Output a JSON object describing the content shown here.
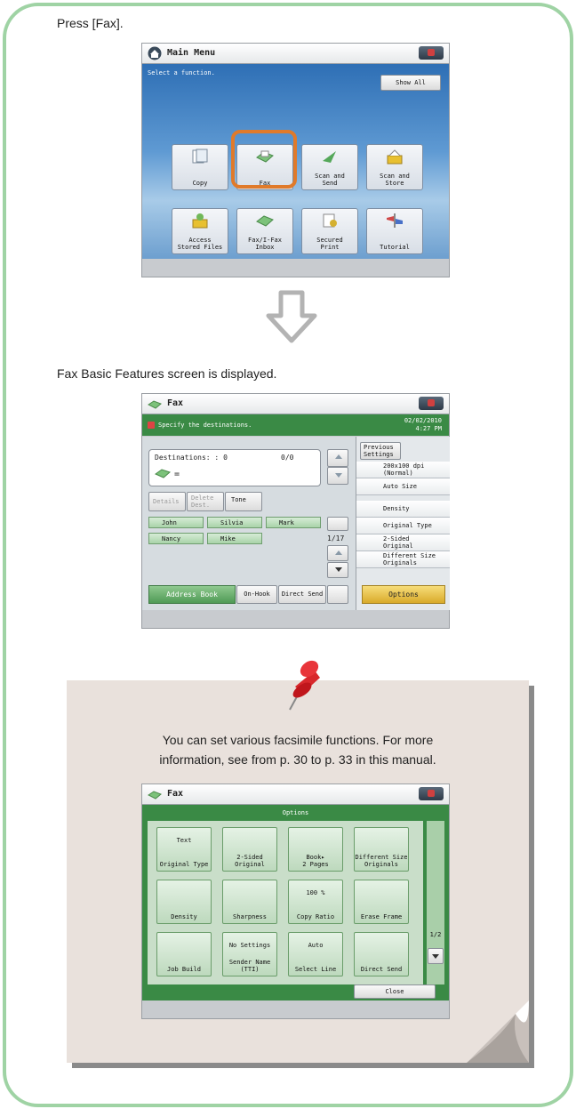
{
  "step1": {
    "text": "Press [Fax]."
  },
  "main_menu": {
    "title": "Main Menu",
    "instruction": "Select a function.",
    "show_all": "Show All",
    "tiles": [
      {
        "label": "Copy"
      },
      {
        "label": "Fax"
      },
      {
        "label": "Scan and\nSend"
      },
      {
        "label": "Scan and\nStore"
      },
      {
        "label": "Access\nStored Files"
      },
      {
        "label": "Fax/I-Fax\nInbox"
      },
      {
        "label": "Secured\nPrint"
      },
      {
        "label": "Tutorial"
      }
    ],
    "highlight_color": "#e07a2a"
  },
  "step2": {
    "text": "Fax Basic Features screen is displayed."
  },
  "fax_screen": {
    "title": "Fax",
    "status_msg": "Specify the destinations.",
    "date": "02/02/2010",
    "time": "4:27 PM",
    "destinations_label": "Destinations: : 0",
    "dest_count": "0/0",
    "equals": "=",
    "details": "Details",
    "delete_dest": "Delete\nDest.",
    "tone": "Tone",
    "names": [
      "John",
      "Silvia",
      "Mark",
      "Nancy",
      "Mike"
    ],
    "page": "1/17",
    "address_book": "Address Book",
    "on_hook": "On-Hook",
    "direct_send": "Direct Send",
    "previous_settings": "Previous\nSettings",
    "resolution": "200x100 dpi\n(Normal)",
    "auto_size": "Auto Size",
    "density": "Density",
    "original_type": "Original Type",
    "two_sided": "2-Sided\nOriginal",
    "different_size": "Different Size\nOriginals",
    "options": "Options"
  },
  "note": {
    "text_line1": "You can set various facsimile functions. For more",
    "text_line2": "information, see from p. 30 to p. 33 in this manual."
  },
  "options_screen": {
    "title": "Fax",
    "header": "Options",
    "tiles": [
      {
        "value": "Text",
        "label": "Original Type"
      },
      {
        "value": "",
        "label": "2-Sided\nOriginal"
      },
      {
        "value": "Book▸\n2 Pages",
        "label": ""
      },
      {
        "value": "",
        "label": "Different Size\nOriginals"
      },
      {
        "value": "",
        "label": "Density"
      },
      {
        "value": "",
        "label": "Sharpness"
      },
      {
        "value": "100 %",
        "label": "Copy Ratio"
      },
      {
        "value": "",
        "label": "Erase Frame"
      },
      {
        "value": "",
        "label": "Job Build"
      },
      {
        "value": "No Settings",
        "label": "Sender Name\n(TTI)"
      },
      {
        "value": "Auto",
        "label": "Select Line"
      },
      {
        "value": "",
        "label": "Direct Send"
      }
    ],
    "page": "1/2",
    "close": "Close"
  }
}
